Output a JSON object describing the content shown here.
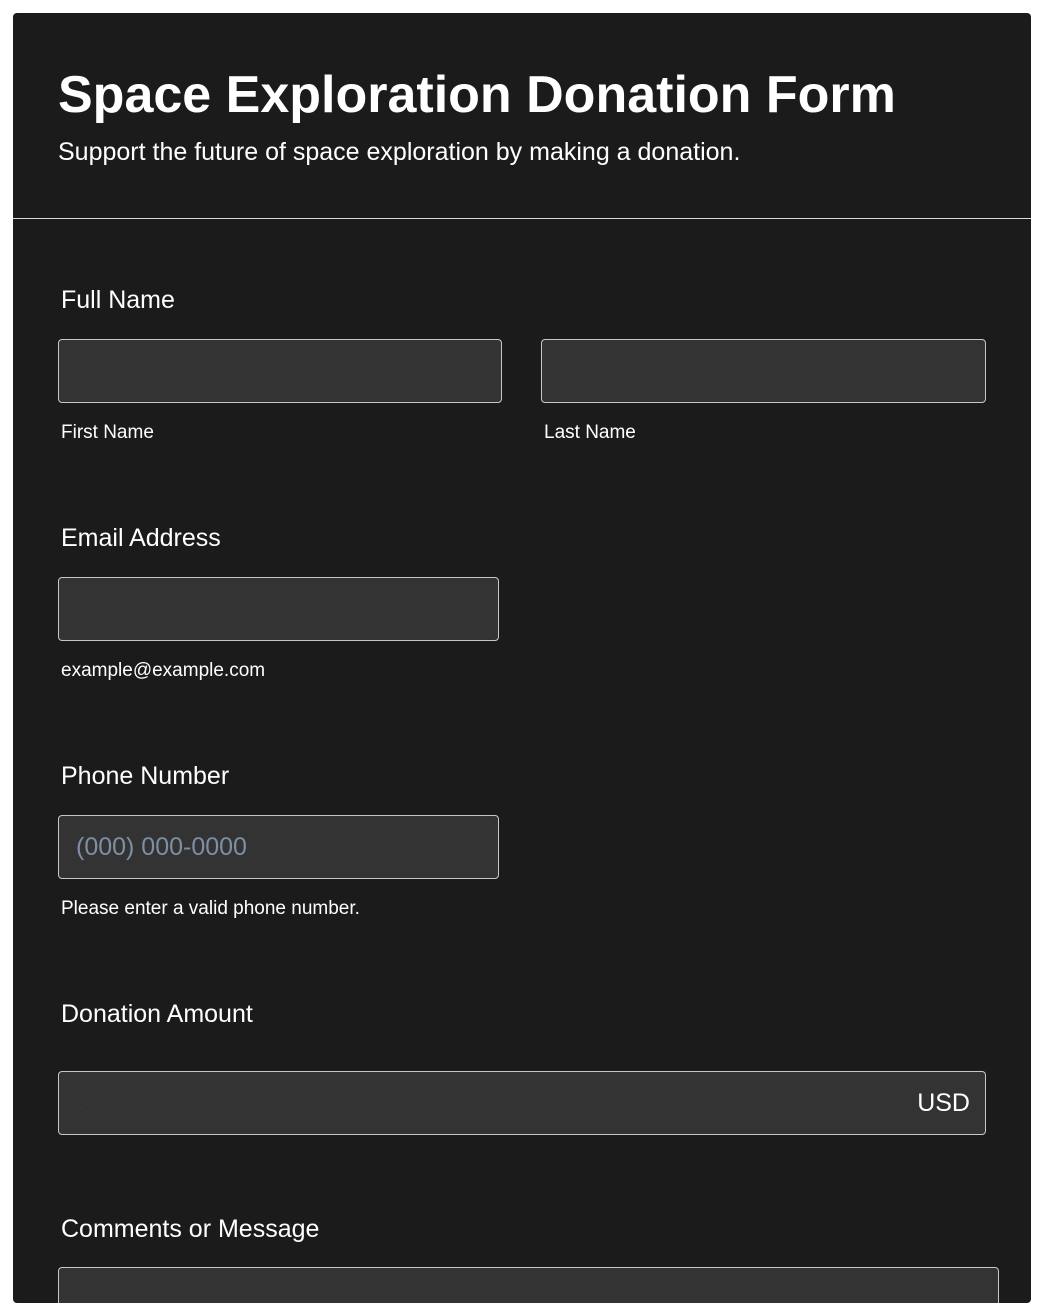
{
  "form": {
    "title": "Space Exploration Donation Form",
    "subtitle": "Support the future of space exploration by making a donation."
  },
  "full_name": {
    "label": "Full Name",
    "first_name": {
      "value": "",
      "sublabel": "First Name"
    },
    "last_name": {
      "value": "",
      "sublabel": "Last Name"
    }
  },
  "email": {
    "label": "Email Address",
    "value": "",
    "sublabel": "example@example.com"
  },
  "phone": {
    "label": "Phone Number",
    "value": "",
    "placeholder": "(000) 000-0000",
    "sublabel": "Please enter a valid phone number."
  },
  "donation": {
    "label": "Donation Amount",
    "value": "",
    "currency": "USD",
    "icon": "currency-icon"
  },
  "comments": {
    "label": "Comments or Message",
    "value": ""
  },
  "colors": {
    "card_background": "#1b1b1c",
    "input_background": "#333334",
    "input_border": "#c8c8c8",
    "text": "#ffffff",
    "placeholder": "#7f8ea3"
  }
}
